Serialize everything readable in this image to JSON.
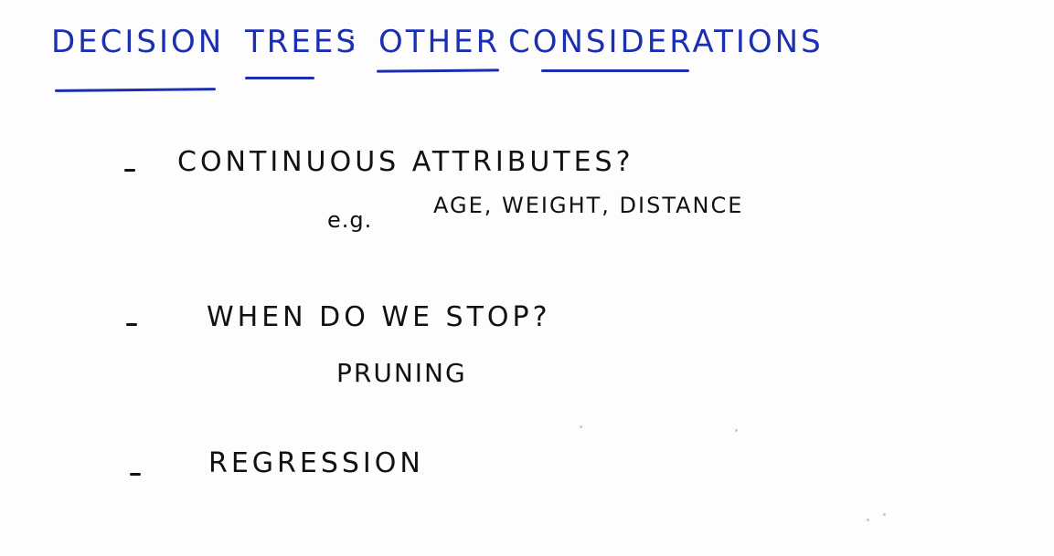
{
  "title": {
    "word1": "Decision",
    "word2": "Trees",
    "colon": ":",
    "word3": "Other",
    "word4": "Considerations"
  },
  "bullets": [
    {
      "marker": "-",
      "text": "Continuous Attributes?",
      "sub_prefix": "e.g.",
      "sub_text": "Age, Weight, Distance"
    },
    {
      "marker": "-",
      "text": "When do we stop?",
      "sub_text": "Pruning"
    },
    {
      "marker": "-",
      "text": "Regression"
    }
  ],
  "colors": {
    "title_ink": "#1b2fb0",
    "body_ink": "#111111",
    "background": "#fdfdfd"
  }
}
